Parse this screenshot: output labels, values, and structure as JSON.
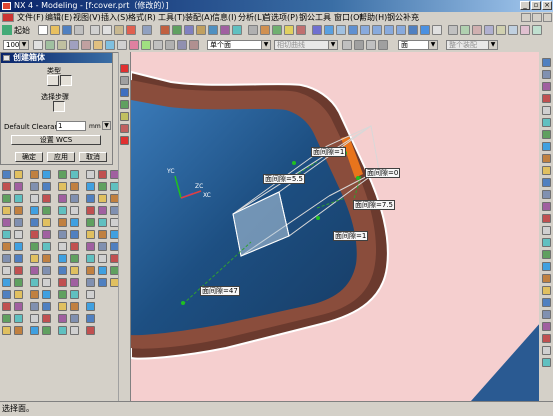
{
  "window": {
    "title": "NX 4 - Modeling - [f:cover.prt（修改的）]",
    "minimize": "_",
    "restore": "▫",
    "close": "×"
  },
  "menu": [
    "文件(F)",
    "编辑(E)",
    "视图(V)",
    "插入(S)",
    "格式(R)",
    "工具(T)",
    "装配(A)",
    "信息(I)",
    "分析(L)",
    "首选项(P)",
    "钢公工具",
    "窗口(O)",
    "帮助(H)",
    "钢公补充"
  ],
  "toolbar": {
    "start_label": "起始",
    "filter_value": "单个面",
    "curve_rule_value": "相切曲线",
    "face_value": "面",
    "feature_value": "整个装配",
    "zoom_value": "100"
  },
  "dialog": {
    "title": "创建箱体",
    "type_label": "类型",
    "selection_steps_label": "选择步骤",
    "clearance_label": "Default Clearance",
    "clearance_value": "1",
    "unit": "mm",
    "wcs_button": "设置 WCS",
    "ok": "确定",
    "apply": "应用",
    "cancel": "取消"
  },
  "annotations": {
    "a1": "面间隙=1",
    "a2": "面间隙=0",
    "a3": "面间隙=5.5",
    "a4": "面间隙=7.5",
    "a5": "面间隙=1",
    "a6": "面间隙=47"
  },
  "axes": {
    "xc": "XC",
    "yc": "YC",
    "zc": "ZC"
  },
  "status": "选择面。",
  "colors": {
    "background": "#f4cccc",
    "shell": "#6b3a2e",
    "surface_blue": "#1d4f82",
    "accent_orange": "#e8741c",
    "title_blue": "#0a246a"
  }
}
